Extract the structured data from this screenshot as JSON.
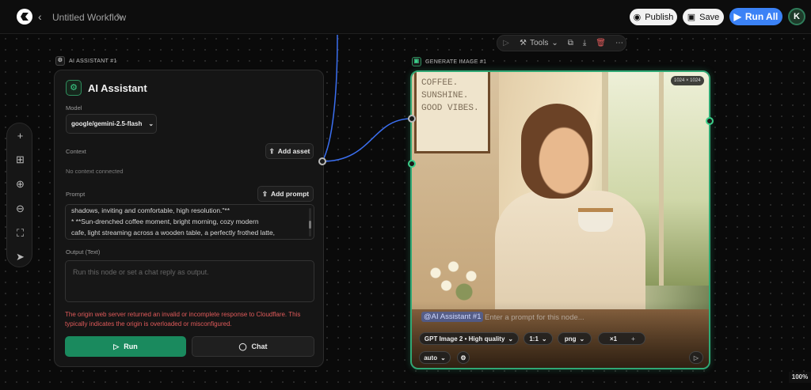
{
  "header": {
    "back_icon": "chevron-left-icon",
    "workflow_title": "Untitled Workflow",
    "edit_icon": "edit-icon",
    "publish_label": "Publish",
    "save_label": "Save",
    "run_all_label": "Run All",
    "avatar_initial": "K"
  },
  "floating_toolbar": {
    "tools_label": "Tools"
  },
  "side_tools": [
    "plus-icon",
    "toolbox-icon",
    "zoom-in-icon",
    "zoom-out-icon",
    "fit-screen-icon",
    "pointer-icon"
  ],
  "ai_node": {
    "header_label": "AI ASSISTANT #1",
    "title": "AI Assistant",
    "model_label": "Model",
    "model_value": "google/gemini-2.5-flash",
    "context_label": "Context",
    "add_asset_label": "Add asset",
    "no_context": "No context connected",
    "prompt_label": "Prompt",
    "add_prompt_label": "Add prompt",
    "prompt_lines": [
      "shadows, inviting and comfortable, high resolution.\"**",
      "*   **Sun-drenched coffee moment, bright morning, cozy modern",
      "cafe, light streaming across a wooden table, a perfectly frothed latte,"
    ],
    "output_label": "Output (Text)",
    "output_placeholder": "Run this node or set a chat reply as output.",
    "error_text": "The origin web server returned an invalid or incomplete response to Cloudflare. This typically indicates the origin is overloaded or misconfigured.",
    "run_label": "Run",
    "chat_label": "Chat"
  },
  "image_node": {
    "header_label": "GENERATE IMAGE #1",
    "size_badge": "1024 × 1024",
    "sign_lines": [
      "COFFEE.",
      "SUNSHINE.",
      "GOOD VIBES."
    ],
    "mention_tag": "@AI Assistant #1",
    "prompt_placeholder": "Enter a prompt for this node...",
    "model_pill": "GPT Image 2 • High quality",
    "ratio_pill": "1:1",
    "format_pill": "png",
    "count_pill": "×1",
    "add_icon": "plus-icon",
    "auto_pill": "auto",
    "settings_icon": "gear-icon"
  },
  "zoom_level": "100%"
}
